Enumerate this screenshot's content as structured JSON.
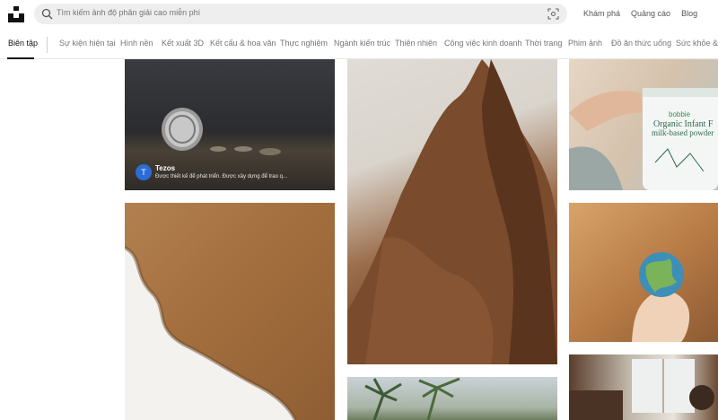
{
  "header": {
    "search_placeholder": "Tìm kiếm ảnh độ phân giải cao miễn phí",
    "links": [
      "Khám phá",
      "Quảng cáo",
      "Blog"
    ]
  },
  "categories": [
    "Biên tập",
    "Sự kiện hiện tại",
    "Hình nền",
    "Kết xuất 3D",
    "Kết cấu & hoa văn",
    "Thực nghiệm",
    "Ngành kiến trúc",
    "Thiên nhiên",
    "Công việc kinh doanh",
    "Thời trang",
    "Phim ảnh",
    "Đồ ăn thức uống",
    "Sức khỏe & S"
  ],
  "sponsor": {
    "avatar": "T",
    "name": "Tezos",
    "description": "Được thiết kế để phát triển. Được xây dựng để trao q..."
  },
  "product": {
    "brand": "bobbie",
    "line1": "Organic Infant F",
    "line2": "milk-based powder"
  },
  "icons": {
    "logo": "unsplash-logo-icon",
    "search": "search-icon",
    "visual_search": "visual-search-icon"
  },
  "colors": {
    "accent_avatar": "#2b6cd6",
    "search_bg": "#eeeeee"
  }
}
